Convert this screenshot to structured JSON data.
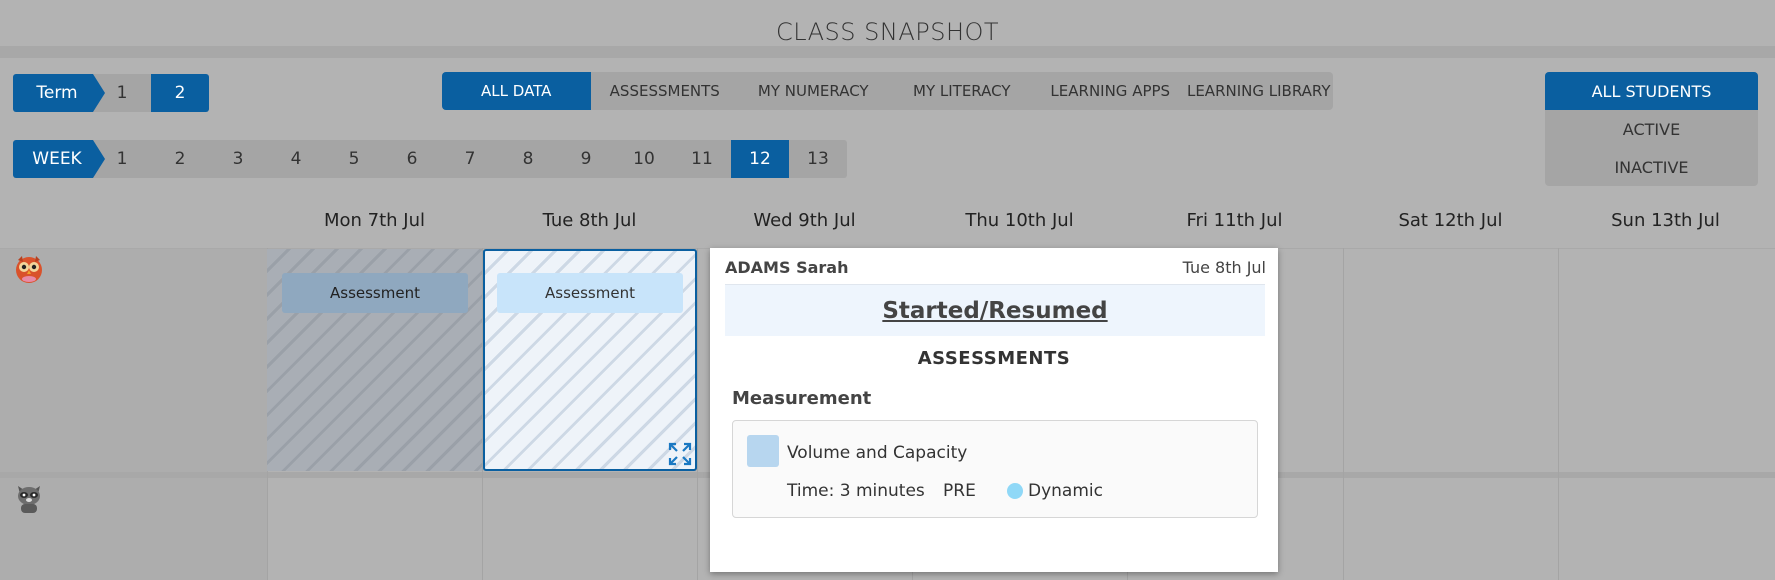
{
  "page": {
    "title": "CLASS SNAPSHOT"
  },
  "term": {
    "label": "Term",
    "options": [
      "1",
      "2"
    ],
    "selected": "2"
  },
  "week": {
    "label": "WEEK",
    "options": [
      "1",
      "2",
      "3",
      "4",
      "5",
      "6",
      "7",
      "8",
      "9",
      "10",
      "11",
      "12",
      "13"
    ],
    "selected": "12"
  },
  "tabs": [
    "ALL DATA",
    "ASSESSMENTS",
    "MY NUMERACY",
    "MY LITERACY",
    "LEARNING APPS",
    "LEARNING LIBRARY"
  ],
  "tabs_selected": "ALL DATA",
  "student_filter": {
    "options": [
      "ALL STUDENTS",
      "ACTIVE",
      "INACTIVE"
    ],
    "selected": "ALL STUDENTS"
  },
  "days": [
    "Mon 7th Jul",
    "Tue 8th Jul",
    "Wed 9th Jul",
    "Thu 10th Jul",
    "Fri 11th Jul",
    "Sat 12th Jul",
    "Sun 13th Jul"
  ],
  "rows": [
    {
      "avatar_icon": "owl-avatar-icon",
      "entries": {
        "mon": "Assessment",
        "tue": "Assessment"
      }
    },
    {
      "avatar_icon": "raccoon-avatar-icon",
      "entries": {}
    }
  ],
  "popup": {
    "student": "ADAMS Sarah",
    "date": "Tue 8th Jul",
    "status": "Started/Resumed",
    "category": "ASSESSMENTS",
    "strand": "Measurement",
    "skill": "Volume and Capacity",
    "time": "Time: 3 minutes",
    "phase": "PRE",
    "mode": "Dynamic"
  },
  "colors": {
    "accent": "#0a5fa0",
    "background": "#b3b3b3",
    "chip_light": "#c8e4fa",
    "dynamic_dot": "#8fd8f7"
  }
}
